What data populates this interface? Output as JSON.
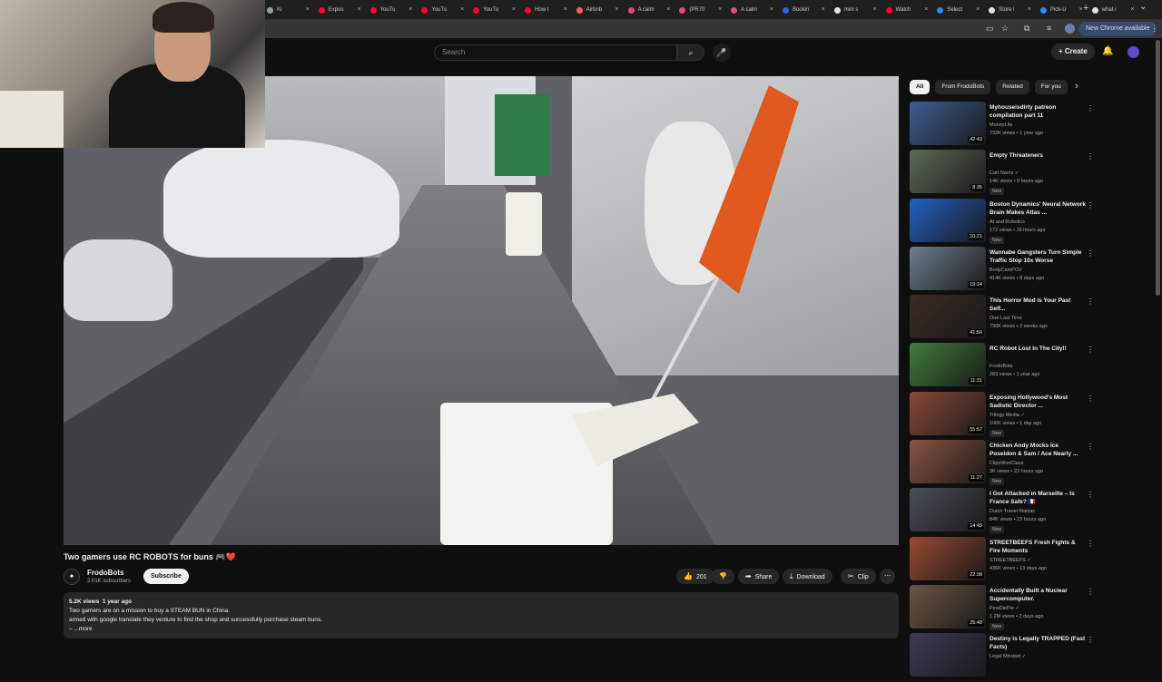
{
  "browser": {
    "tabs": [
      {
        "label": "Ki",
        "color": "#9aa0a6"
      },
      {
        "label": "Expos",
        "color": "#ff0033"
      },
      {
        "label": "YouTu",
        "color": "#ff0033"
      },
      {
        "label": "YouTu",
        "color": "#ff0033"
      },
      {
        "label": "YouTu",
        "color": "#ff0033"
      },
      {
        "label": "How t",
        "color": "#ff0033"
      },
      {
        "label": "Airbnb",
        "color": "#ff5a5f"
      },
      {
        "label": "A calm",
        "color": "#e24a7a"
      },
      {
        "label": "(PR70",
        "color": "#e24a7a"
      },
      {
        "label": "A calm",
        "color": "#e24a7a"
      },
      {
        "label": "Bookin",
        "color": "#2b62d9"
      },
      {
        "label": "mini s",
        "color": "#e0e0e0"
      },
      {
        "label": "Watch",
        "color": "#ff0033"
      },
      {
        "label": "Select",
        "color": "#3b82f6"
      },
      {
        "label": "Store l",
        "color": "#e0e0e0"
      },
      {
        "label": "Pick-U",
        "color": "#3b82f6"
      },
      {
        "label": "what i",
        "color": "#e0e0e0"
      }
    ],
    "new_tab": "+",
    "update_label": "New Chrome available"
  },
  "header": {
    "search_placeholder": "Search",
    "create_label": "Create"
  },
  "video": {
    "title": "Two gamers use RC ROBOTS for buns 🎮❤️",
    "channel": "FrodoBots",
    "subscribers": "2.01K subscribers",
    "subscribe_label": "Subscribe",
    "likes": "201",
    "share_label": "Share",
    "download_label": "Download",
    "clip_label": "Clip",
    "views": "5.2K views",
    "age": "1 year ago",
    "description_line1": "Two gamers are on a mission to buy a STEAM BUN in China.",
    "description_line2": "armed with google translate they venture to find the shop and successfully purchase steam buns.",
    "more_label": "...more"
  },
  "chips": {
    "items": [
      "All",
      "From FrodoBots",
      "Related",
      "For you"
    ]
  },
  "recommendations": [
    {
      "title": "Myhouseisdirty patreon compilation part 11",
      "channel": "MoneyLife",
      "stats": "732K views • 1 year ago",
      "badge": "",
      "duration": "42:43",
      "color": "#3b5f93"
    },
    {
      "title": "Empty Threateners",
      "channel": "Cart Narcs ✓",
      "stats": "14K views • 9 hours ago",
      "badge": "New",
      "duration": "8:35",
      "color": "#5d6b57"
    },
    {
      "title": "Boston Dynamics' Neural Network Brain Makes Atlas ...",
      "channel": "AI and Robotics",
      "stats": "172 views • 19 hours ago",
      "badge": "New",
      "duration": "10:21",
      "color": "#2160c4"
    },
    {
      "title": "Wannabe Gangsters Turn Simple Traffic Stop 10x Worse",
      "channel": "BodyCamPOV",
      "stats": "414K views • 8 days ago",
      "badge": "",
      "duration": "19:24",
      "color": "#6e7f8c"
    },
    {
      "title": "This Horror Mod is Your Past Self...",
      "channel": "One Last Time",
      "stats": "790K views • 2 weeks ago",
      "badge": "",
      "duration": "41:56",
      "color": "#3a2b25"
    },
    {
      "title": "RC Robot Lost In The City!!",
      "channel": "FrodoBots",
      "stats": "283 views • 1 year ago",
      "badge": "",
      "duration": "11:31",
      "color": "#3f7e3a"
    },
    {
      "title": "Exposing Hollywood's Most Sadistic Director ...",
      "channel": "Trilogy Media ✓",
      "stats": "106K views • 1 day ago",
      "badge": "New",
      "duration": "55:57",
      "color": "#8a4a37"
    },
    {
      "title": "Chicken Andy Mocks Ice Poseidon & Sam / Ace Nearly ...",
      "channel": "ClipsWonClaus",
      "stats": "3K views • 23 hours ago",
      "badge": "New",
      "duration": "11:27",
      "color": "#8a5542"
    },
    {
      "title": "I Got Attacked in Marseille – Is France Safe? 🇫🇷",
      "channel": "Dutch Travel Maniac",
      "stats": "84K views • 23 hours ago",
      "badge": "New",
      "duration": "14:49",
      "color": "#4a4e58"
    },
    {
      "title": "STREETBEEFS Fresh Fights & Fire Moments",
      "channel": "STREETBEEFS ✓",
      "stats": "436K views • 13 days ago",
      "badge": "",
      "duration": "22:38",
      "color": "#9a4b2e"
    },
    {
      "title": "Accidentally Built a Nuclear Supercomputer.",
      "channel": "PewDiePie ✓",
      "stats": "1.2M views • 2 days ago",
      "badge": "New",
      "duration": "25:48",
      "color": "#6b5644"
    },
    {
      "title": "Destiny is Legally TRAPPED (Fast Facts)",
      "channel": "Legal Mindset ✓",
      "stats": "",
      "badge": "",
      "duration": "",
      "color": "#3d3a54"
    }
  ]
}
